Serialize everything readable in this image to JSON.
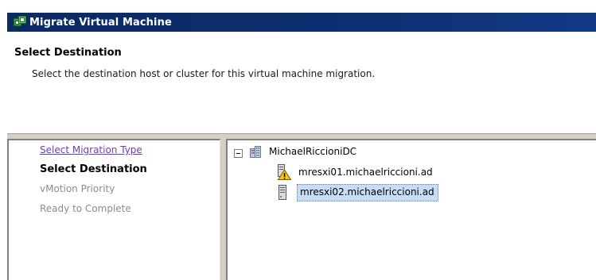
{
  "window": {
    "title": "Migrate Virtual Machine",
    "icon": "vsphere-migrate-icon"
  },
  "header": {
    "title": "Select Destination",
    "description": "Select the destination host or cluster for this virtual machine migration."
  },
  "wizard_steps": [
    {
      "label": "Select Migration Type",
      "state": "completed-link"
    },
    {
      "label": "Select Destination",
      "state": "current"
    },
    {
      "label": "vMotion Priority",
      "state": "disabled"
    },
    {
      "label": "Ready to Complete",
      "state": "disabled"
    }
  ],
  "tree": {
    "datacenter": {
      "label": "MichaelRiccioniDC",
      "icon": "datacenter-icon",
      "expanded": true
    },
    "hosts": [
      {
        "label": "mresxi01.michaelriccioni.ad",
        "icon": "host-warning-icon",
        "selected": false
      },
      {
        "label": "mresxi02.michaelriccioni.ad",
        "icon": "host-icon",
        "selected": true
      }
    ]
  },
  "colors": {
    "title_bar": "#0c2a63",
    "link": "#6a3fb0",
    "selection": "#c8dcf5",
    "panel_bg": "#d4d0c8"
  }
}
